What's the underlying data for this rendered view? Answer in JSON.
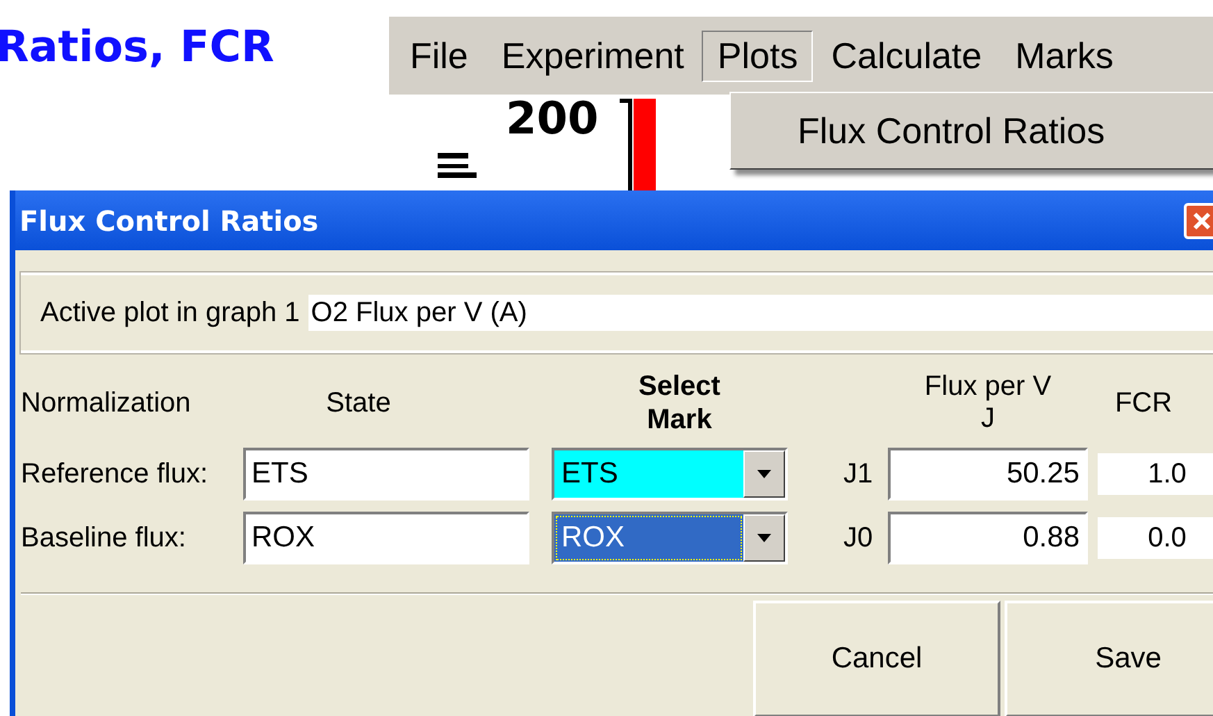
{
  "page_heading": "Ratios, FCR",
  "chart": {
    "tick_label": "200"
  },
  "menu_bar": [
    {
      "label": "File",
      "selected": false
    },
    {
      "label": "Experiment",
      "selected": false
    },
    {
      "label": "Plots",
      "selected": true
    },
    {
      "label": "Calculate",
      "selected": false
    },
    {
      "label": "Marks",
      "selected": false
    }
  ],
  "menu": {
    "items": [
      "Flux Control Ratios"
    ]
  },
  "dialog": {
    "title": "Flux Control Ratios",
    "active_plot": {
      "label": "Active plot in graph 1",
      "value": "O2 Flux per V (A)"
    },
    "columns": {
      "normalization": "Normalization",
      "state": "State",
      "select_mark": "Select Mark",
      "flux": "Flux per V",
      "flux_unit": "J",
      "fcr": "FCR"
    },
    "rows": [
      {
        "label": "Reference flux:",
        "state": "ETS",
        "mark": "ETS",
        "color": "#00ffff",
        "focused": false,
        "j": "J1",
        "flux": "50.25",
        "fcr": "1.0"
      },
      {
        "label": "Baseline flux:",
        "state": "ROX",
        "mark": "ROX",
        "color": "#316ac5",
        "focused": true,
        "j": "J0",
        "flux": "0.88",
        "fcr": "0.0"
      }
    ],
    "buttons": [
      "Cancel",
      "Save"
    ]
  }
}
